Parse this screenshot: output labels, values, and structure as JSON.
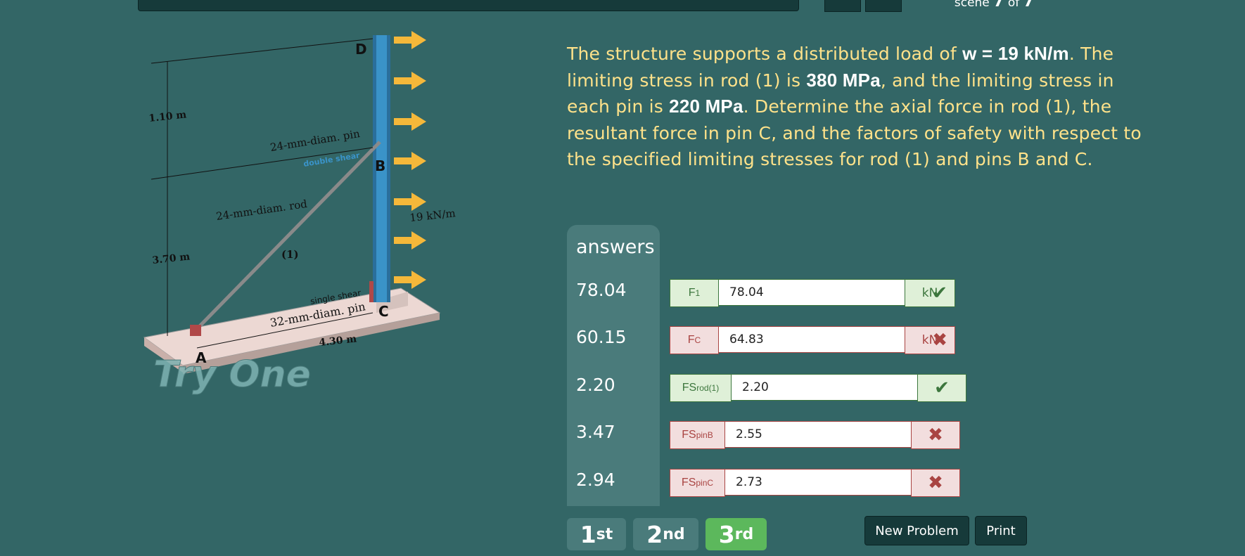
{
  "header": {
    "scene_label": "scene",
    "scene_current": "7",
    "scene_of": "of",
    "scene_total": "7"
  },
  "figure": {
    "labels": {
      "D": "D",
      "B": "B",
      "C": "C",
      "A": "A",
      "dim_top": "1.10 m",
      "dim_bottom": "3.70 m",
      "dim_base": "4.30 m",
      "pin_b": "24-mm-diam. pin",
      "pin_b_shear": "double shear",
      "rod": "24-mm-diam. rod",
      "rod_num": "(1)",
      "pin_c_shear": "single shear",
      "pin_c": "32-mm-diam. pin",
      "load": "19 kN/m",
      "watermark": "Try One"
    }
  },
  "problem": {
    "t1": "The structure supports a distributed load of ",
    "w": "w = 19 kN/m",
    "t2": ". The limiting stress in rod (1) is ",
    "s1": "380 MPa",
    "t3": ", and the limiting stress in each pin is ",
    "s2": "220 MPa",
    "t4": ". Determine the axial force in rod (1), the resultant force in pin C, and the factors of safety with respect to the specified limiting stresses for rod (1) and pins B and C."
  },
  "answers": {
    "header": "answers",
    "values": [
      "78.04",
      "60.15",
      "2.20",
      "3.47",
      "2.94"
    ]
  },
  "rows": [
    {
      "label_main": "F",
      "label_sub": "1",
      "value": "78.04",
      "unit": "kN",
      "status": "correct",
      "mark": "✔"
    },
    {
      "label_main": "F",
      "label_sub": "C",
      "value": "64.83",
      "unit": "kN",
      "status": "incorrect",
      "mark": "✖"
    },
    {
      "label_main": "FS",
      "label_sub": "rod(1)",
      "value": "2.20",
      "unit": "",
      "status": "correct",
      "mark": "✔"
    },
    {
      "label_main": "FS",
      "label_sub": "pinB",
      "value": "2.55",
      "unit": "",
      "status": "incorrect",
      "mark": "✖"
    },
    {
      "label_main": "FS",
      "label_sub": "pinC",
      "value": "2.73",
      "unit": "",
      "status": "incorrect",
      "mark": "✖"
    }
  ],
  "tabs": [
    {
      "num": "1",
      "suf": "st"
    },
    {
      "num": "2",
      "suf": "nd"
    },
    {
      "num": "3",
      "suf": "rd"
    }
  ],
  "buttons": {
    "new_problem": "New Problem",
    "print": "Print"
  },
  "colors": {
    "background": "#336666",
    "problem_text": "#ffe28a",
    "correct": "#3c763d",
    "incorrect": "#a94442",
    "active_tab": "#5cb85c"
  }
}
